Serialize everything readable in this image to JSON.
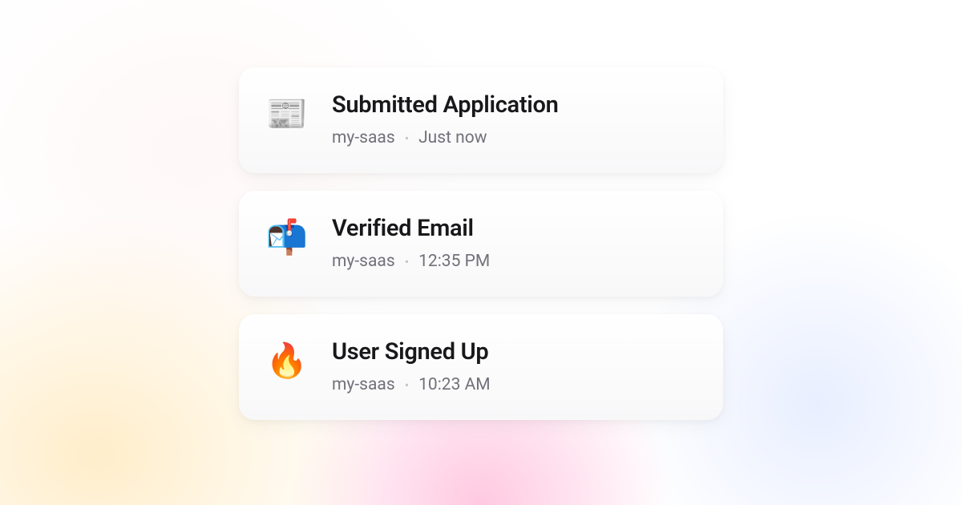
{
  "feed": {
    "items": [
      {
        "icon": "📰",
        "icon_name": "newspaper-icon",
        "title": "Submitted Application",
        "source": "my-saas",
        "time": "Just now"
      },
      {
        "icon": "📬",
        "icon_name": "mailbox-icon",
        "title": "Verified Email",
        "source": "my-saas",
        "time": "12:35 PM"
      },
      {
        "icon": "🔥",
        "icon_name": "fire-icon",
        "title": "User Signed Up",
        "source": "my-saas",
        "time": "10:23 AM"
      }
    ]
  },
  "separator": "•"
}
